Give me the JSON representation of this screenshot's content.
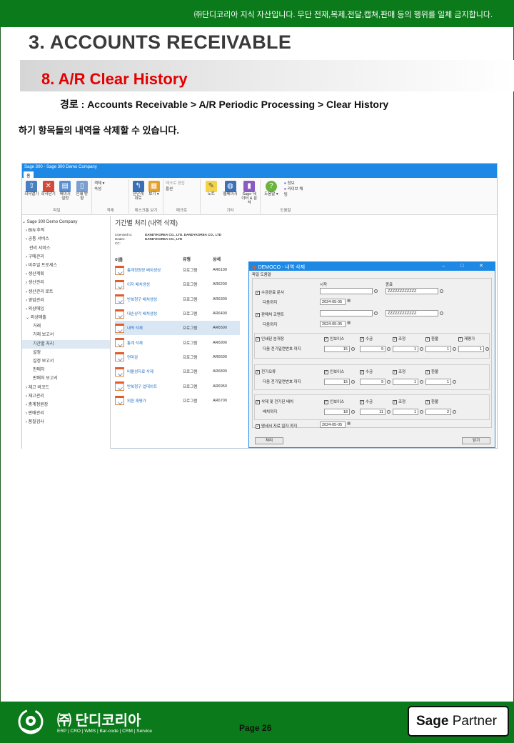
{
  "header": {
    "notice": "㈜단디코리아  지식 자산입니다.  무단 전재,복제,전달,캡쳐,판매  등의 행위를 일체 금지합니다.",
    "chapter": "3. ACCOUNTS RECEIVABLE",
    "section": "8. A/R Clear History",
    "path": "경로 : Accounts Receivable  > A/R Periodic Processing > Clear History",
    "description": "하기 항목들의 내역을 삭제할 수 있습니다."
  },
  "app": {
    "title": "Sage 300 - Sage 300 Demo Company",
    "tab": "홈",
    "ribbon": {
      "file": [
        "회사열기",
        "회사닫기",
        "페이지 설정",
        "인쇄 방향"
      ],
      "file_label": "파일",
      "object": [
        "객체 ▾",
        "속성"
      ],
      "object_label": "객체",
      "desktop": [
        "한단계 위로",
        "보기 ▾"
      ],
      "desktop_label": "데스크톱 보기",
      "macro": [
        "매크로 편집",
        "옵션"
      ],
      "macro_label": "매크로",
      "other": [
        "노트",
        "웹페이지",
        "Sage 데이터 & 분석"
      ],
      "other_label": "기타",
      "help": [
        "도움말 ▾",
        "정보",
        "라이브 채팅"
      ],
      "help_label": "도움말"
    },
    "sidebar": [
      "⌄ Sage 300 Demo Company",
      "   › BIN 추적",
      "   › 공통 서비스",
      "      관리 서비스",
      "   › 구매관리",
      "   › 비주얼 프로세스",
      "   › 생산계획",
      "   › 생산관리",
      "   › 생산관리 로트",
      "   › 영업관리",
      "   › 외상매입",
      "   ⌄ 외상매출",
      "         거래",
      "         거래 보고서",
      "         기간별 처리",
      "         설정",
      "         설정 보고서",
      "         판매처",
      "         판매처 보고서",
      "   › 재고 바코드",
      "   › 재고관리",
      "   › 총계정원장",
      "   › 판매관리",
      "   › 품질검사"
    ],
    "selected_sidebar_index": 14,
    "main": {
      "title": "기간별 처리 (내역 삭제)",
      "licensed_to_key": "Licensed to:",
      "licensed_to": "DANDYKOREA CO., LTD. DANDYKOREA CO., LTD",
      "dealer_key": "Dealer:",
      "dealer": "DANDYKOREA CO., LTD",
      "cc_key": "CC:",
      "cc": "",
      "columns": [
        "이름",
        "유형",
        "상세"
      ],
      "rows": [
        {
          "name": "총계정원장 배치생성",
          "type": "프로그램",
          "code": "AR6100"
        },
        {
          "name": "이자 배치생성",
          "type": "프로그램",
          "code": "AR6200"
        },
        {
          "name": "반복청구 배치생성",
          "type": "프로그램",
          "code": "AR6300"
        },
        {
          "name": "대손상각 배치생성",
          "type": "프로그램",
          "code": "AR6400"
        },
        {
          "name": "내역 삭제",
          "type": "프로그램",
          "code": "AR6500"
        },
        {
          "name": "통계 삭제",
          "type": "프로그램",
          "code": "AR6900"
        },
        {
          "name": "연마감",
          "type": "프로그램",
          "code": "AR6600"
        },
        {
          "name": "비활성자료 삭제",
          "type": "프로그램",
          "code": "AR6800"
        },
        {
          "name": "반복청구 업데이트",
          "type": "프로그램",
          "code": "AR6950"
        },
        {
          "name": "외환 재평가",
          "type": "프로그램",
          "code": "AR6700"
        }
      ],
      "selected_row_index": 4
    }
  },
  "dialog": {
    "title": "DEMOCO - 내역 삭제",
    "menu": "파일  도움말",
    "start_label": "시작",
    "end_label": "종료",
    "rows": {
      "invoice_customer": {
        "label": "수금완료 문서",
        "from": "",
        "to": "ZZZZZZZZZZZZ",
        "until_label": "다음까지",
        "date": "2024-05-05"
      },
      "comments": {
        "label": "판매처 코멘트",
        "from": "",
        "to": "ZZZZZZZZZZZZ",
        "until_label": "다음까지",
        "date": "2024-05-05"
      }
    },
    "printed": {
      "label": "인쇄된 분개장",
      "sub": "다음 전기일련번호 까지",
      "checks": [
        "인보이스",
        "수금",
        "조정",
        "환불",
        "재평가"
      ],
      "values": [
        "15",
        "9",
        "1",
        "1",
        "1"
      ]
    },
    "posting": {
      "label": "전기오류",
      "sub": "다음 전기일련번호 까지",
      "checks": [
        "인보이스",
        "수금",
        "조정",
        "환불"
      ],
      "values": [
        "15",
        "9",
        "1",
        "1"
      ]
    },
    "batches": {
      "label": "삭제 및 전기된 배치",
      "sub": "배치까지",
      "checks": [
        "인보이스",
        "수금",
        "조정",
        "환불"
      ],
      "values": [
        "18",
        "11",
        "1",
        "2"
      ]
    },
    "statements": {
      "label": "명세서 자료 일자 까지",
      "date": "2024-05-05"
    },
    "process_button": "처리",
    "close_button": "닫기"
  },
  "footer": {
    "brand": "㈜ 단디코리아",
    "brand_sub": "ERP | CRO | WMS | Bar-code | CRM | Service",
    "page": "Page 26",
    "partner_sage": "Sage",
    "partner": "Partner"
  }
}
